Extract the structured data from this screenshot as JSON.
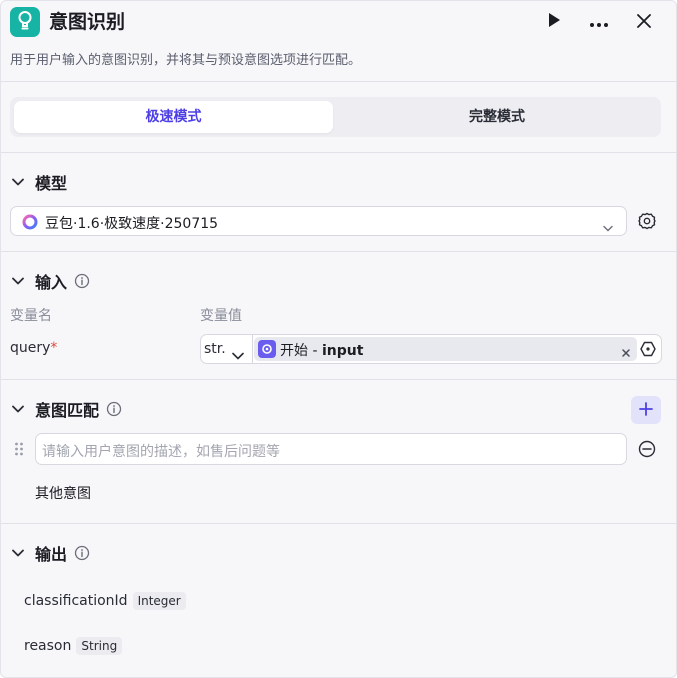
{
  "header": {
    "title": "意图识别",
    "description": "用于用户输入的意图识别，并将其与预设意图选项进行匹配。"
  },
  "modes": {
    "fast_label": "极速模式",
    "full_label": "完整模式",
    "active": "fast"
  },
  "model": {
    "section_label": "模型",
    "selected": "豆包·1.6·极致速度·250715"
  },
  "input": {
    "section_label": "输入",
    "col_name_label": "变量名",
    "col_value_label": "变量值",
    "var_name": "query",
    "required_mark": "*",
    "type_value": "str.",
    "ref_source": "开始",
    "ref_separator": " - ",
    "ref_var": "input"
  },
  "intents": {
    "section_label": "意图匹配",
    "placeholder": "请输入用户意图的描述，如售后问题等",
    "other_label": "其他意图"
  },
  "output": {
    "section_label": "输出",
    "fields": [
      {
        "name": "classificationId",
        "type": "Integer"
      },
      {
        "name": "reason",
        "type": "String"
      }
    ]
  },
  "colors": {
    "accent": "#4e40e5",
    "logo_bg": "#17b3a5",
    "ref_icon_bg": "#6b5cf0",
    "required": "#e0463a"
  }
}
